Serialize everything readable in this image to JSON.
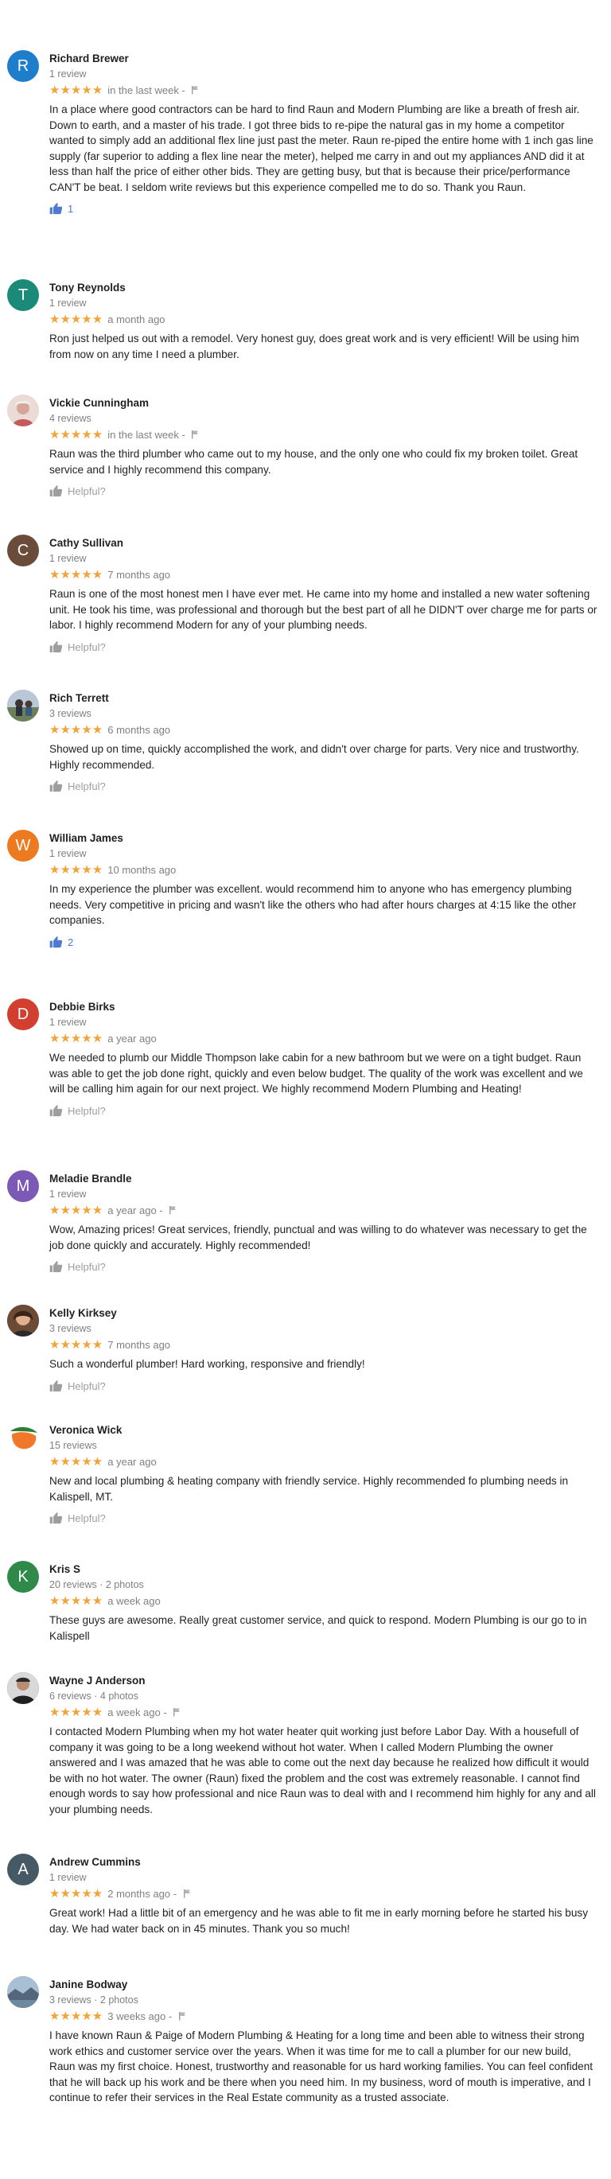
{
  "colors": {
    "star": "#f2a33a",
    "meta": "#808080",
    "helpful_inactive": "#9e9e9e",
    "helpful_active": "#4f7ad1"
  },
  "reviews": [
    {
      "name": "Richard Brewer",
      "meta": "1 review",
      "avatar_letter": "R",
      "avatar_color": "#1e7ecb",
      "stars": "★★★★★",
      "time": "in the last week -",
      "flag": true,
      "text": "In a place where good contractors can be hard to find Raun and Modern Plumbing are like a breath of fresh air. Down to earth, and a master of his trade. I got three bids to re-pipe the natural gas in my home a competitor wanted to simply add an additional flex line just past the meter. Raun re-piped the entire home with 1 inch gas line supply (far superior to adding a flex line near the meter), helped me carry in and out my appliances AND did it at less than half the price of either other bids. They are getting busy, but that is because their price/performance CAN'T be beat. I seldom write reviews but this experience compelled me to do so. Thank you Raun.",
      "helpful": "1",
      "helpful_active": true
    },
    {
      "name": "Tony Reynolds",
      "meta": "1 review",
      "avatar_letter": "T",
      "avatar_color": "#1b8a78",
      "stars": "★★★★★",
      "time": "a month ago",
      "flag": false,
      "text": "Ron just helped us out with a remodel.  Very honest guy, does great work and is very efficient! Will be using him from now on any time I need a plumber.",
      "helpful": "",
      "helpful_active": false
    },
    {
      "name": "Vickie Cunningham",
      "meta": "4 reviews",
      "avatar_letter": "",
      "avatar_color": "#e9d6d2",
      "stars": "★★★★★",
      "time": "in the last week -",
      "flag": true,
      "text": "Raun was the third plumber who came out to my house, and the only one who could fix my broken toilet. Great service and I highly recommend this company.",
      "helpful": "Helpful?",
      "helpful_active": false
    },
    {
      "name": "Cathy Sullivan",
      "meta": "1 review",
      "avatar_letter": "C",
      "avatar_color": "#6b4c3b",
      "stars": "★★★★★",
      "time": "7 months ago",
      "flag": false,
      "text": "Raun is one of the most honest men I have ever met. He came into my home and installed a new water softening unit.  He took his time, was professional and thorough but the best part of all he DIDN'T over charge me for parts or labor.  I highly recommend Modern for any of your plumbing needs.",
      "helpful": "Helpful?",
      "helpful_active": false
    },
    {
      "name": "Rich Terrett",
      "meta": "3 reviews",
      "avatar_letter": "",
      "avatar_color": "#8ea0b8",
      "stars": "★★★★★",
      "time": "6 months ago",
      "flag": false,
      "text": "Showed up on time, quickly accomplished the work, and didn't over charge for parts.  Very nice and trustworthy.  Highly recommended.",
      "helpful": "Helpful?",
      "helpful_active": false
    },
    {
      "name": "William James",
      "meta": "1 review",
      "avatar_letter": "W",
      "avatar_color": "#ee7a1f",
      "stars": "★★★★★",
      "time": "10 months ago",
      "flag": false,
      "text": "In my experience the plumber was excellent. would recommend him to anyone who has emergency plumbing needs. Very competitive in pricing and wasn't like the others who had after hours charges at 4:15 like the other companies.",
      "helpful": "2",
      "helpful_active": true
    },
    {
      "name": "Debbie Birks",
      "meta": "1 review",
      "avatar_letter": "D",
      "avatar_color": "#d23f2e",
      "stars": "★★★★★",
      "time": "a year ago",
      "flag": false,
      "text": "We needed to plumb our Middle Thompson lake cabin for a new bathroom but we were on a tight budget.  Raun was able to get the job done right, quickly and even below budget.  The quality of the work was excellent and we will be calling him again for our next project.  We highly recommend Modern Plumbing and Heating!",
      "helpful": "Helpful?",
      "helpful_active": false
    },
    {
      "name": "Meladie Brandle",
      "meta": "1 review",
      "avatar_letter": "M",
      "avatar_color": "#7d59b6",
      "stars": "★★★★★",
      "time": "a year ago -",
      "flag": true,
      "text": "Wow, Amazing prices! Great services, friendly, punctual and was willing to do whatever was necessary to get the job done quickly and accurately. Highly recommended!",
      "helpful": "Helpful?",
      "helpful_active": false
    },
    {
      "name": "Kelly Kirksey",
      "meta": "3 reviews",
      "avatar_letter": "",
      "avatar_color": "#5a4030",
      "stars": "★★★★★",
      "time": "7 months ago",
      "flag": false,
      "text": "Such a wonderful plumber! Hard working, responsive and friendly!",
      "helpful": "Helpful?",
      "helpful_active": false
    },
    {
      "name": "Veronica Wick",
      "meta": "15 reviews",
      "avatar_letter": "",
      "avatar_color": "#ffffff",
      "stars": "★★★★★",
      "time": "a year ago",
      "flag": false,
      "text": "New and local plumbing & heating company with friendly service. Highly recommended fo plumbing needs in Kalispell, MT.",
      "helpful": "Helpful?",
      "helpful_active": false
    },
    {
      "name": "Kris S",
      "meta": "20 reviews · 2 photos",
      "avatar_letter": "K",
      "avatar_color": "#2f8a4a",
      "stars": "★★★★★",
      "time": "a week ago",
      "flag": false,
      "text": "These guys are awesome. Really great customer service, and quick to respond. Modern Plumbing is our go to in Kalispell",
      "helpful": "",
      "helpful_active": false
    },
    {
      "name": "Wayne J Anderson",
      "meta": "6 reviews · 4 photos",
      "avatar_letter": "",
      "avatar_color": "#3a3a3a",
      "stars": "★★★★★",
      "time": "a week ago -",
      "flag": true,
      "text": "I contacted Modern Plumbing when my hot water heater quit working just before Labor Day. With a housefull of company it was going to be a long weekend without hot water. When I called Modern Plumbing the owner answered and I was amazed that he was able to come out the next day because he realized how difficult it would be with no hot water. The owner (Raun) fixed the problem and the cost was extremely reasonable. I cannot find enough words to say how professional and nice Raun was to deal with and I recommend him highly for any and all your plumbing needs.",
      "helpful": "",
      "helpful_active": false
    },
    {
      "name": "Andrew Cummins",
      "meta": "1 review",
      "avatar_letter": "A",
      "avatar_color": "#455a64",
      "stars": "★★★★★",
      "time": "2 months ago -",
      "flag": true,
      "text": "Great work! Had a little bit of an emergency and he was able to fit me in early morning before he started his busy day. We had water back on in 45 minutes. Thank you so much!",
      "helpful": "",
      "helpful_active": false
    },
    {
      "name": "Janine Bodway",
      "meta": "3 reviews · 2 photos",
      "avatar_letter": "",
      "avatar_color": "#7f9bb3",
      "stars": "★★★★★",
      "time": "3 weeks ago -",
      "flag": true,
      "text": "I have known Raun & Paige of Modern Plumbing & Heating for a long time and been able to witness their strong work ethics and customer service over the years.  When it was time for me to call a plumber for our new build, Raun was my first choice. Honest, trustworthy and reasonable for us hard working families.  You can feel confident that he will back up his work and be there when you need him.  In my business, word of mouth is imperative, and I continue to refer their services in the Real Estate community as a trusted associate.",
      "helpful": "",
      "helpful_active": false
    }
  ]
}
